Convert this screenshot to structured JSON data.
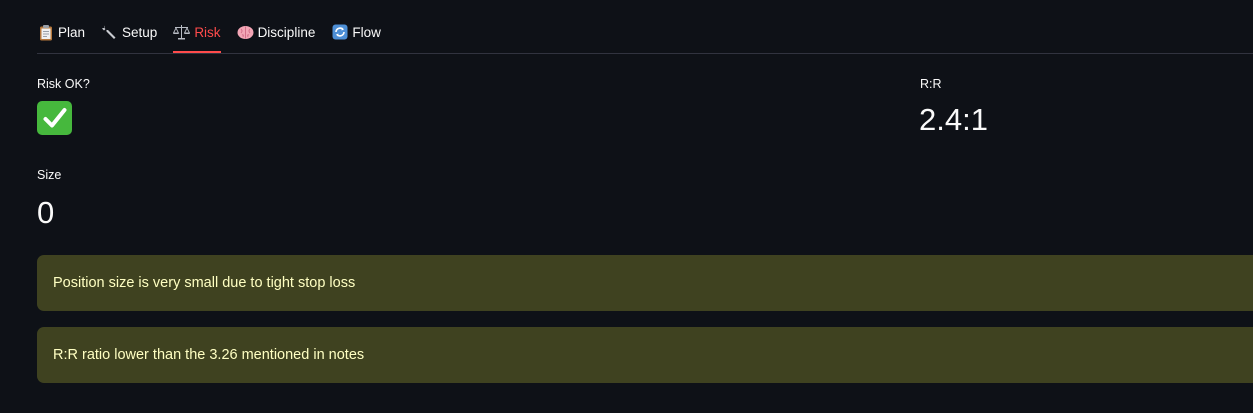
{
  "tabs": [
    {
      "label": "Plan",
      "icon": "clipboard-icon"
    },
    {
      "label": "Setup",
      "icon": "wrench-icon"
    },
    {
      "label": "Risk",
      "icon": "balance-scale-icon",
      "active": true
    },
    {
      "label": "Discipline",
      "icon": "brain-icon"
    },
    {
      "label": "Flow",
      "icon": "refresh-icon"
    }
  ],
  "metrics": {
    "risk_ok": {
      "label": "Risk OK?",
      "icon": "check-mark-icon"
    },
    "rr": {
      "label": "R:R",
      "value": "2.4:1"
    },
    "size": {
      "label": "Size",
      "value": "0"
    }
  },
  "alerts": [
    {
      "text": "Position size is very small due to tight stop loss"
    },
    {
      "text": "R:R ratio lower than the 3.26 mentioned in notes"
    }
  ],
  "colors": {
    "background": "#0e1117",
    "accent": "#ff4b4b",
    "warning_bg": "#3f4220",
    "warning_text": "#ffffc2",
    "check_green": "#46b83d"
  }
}
